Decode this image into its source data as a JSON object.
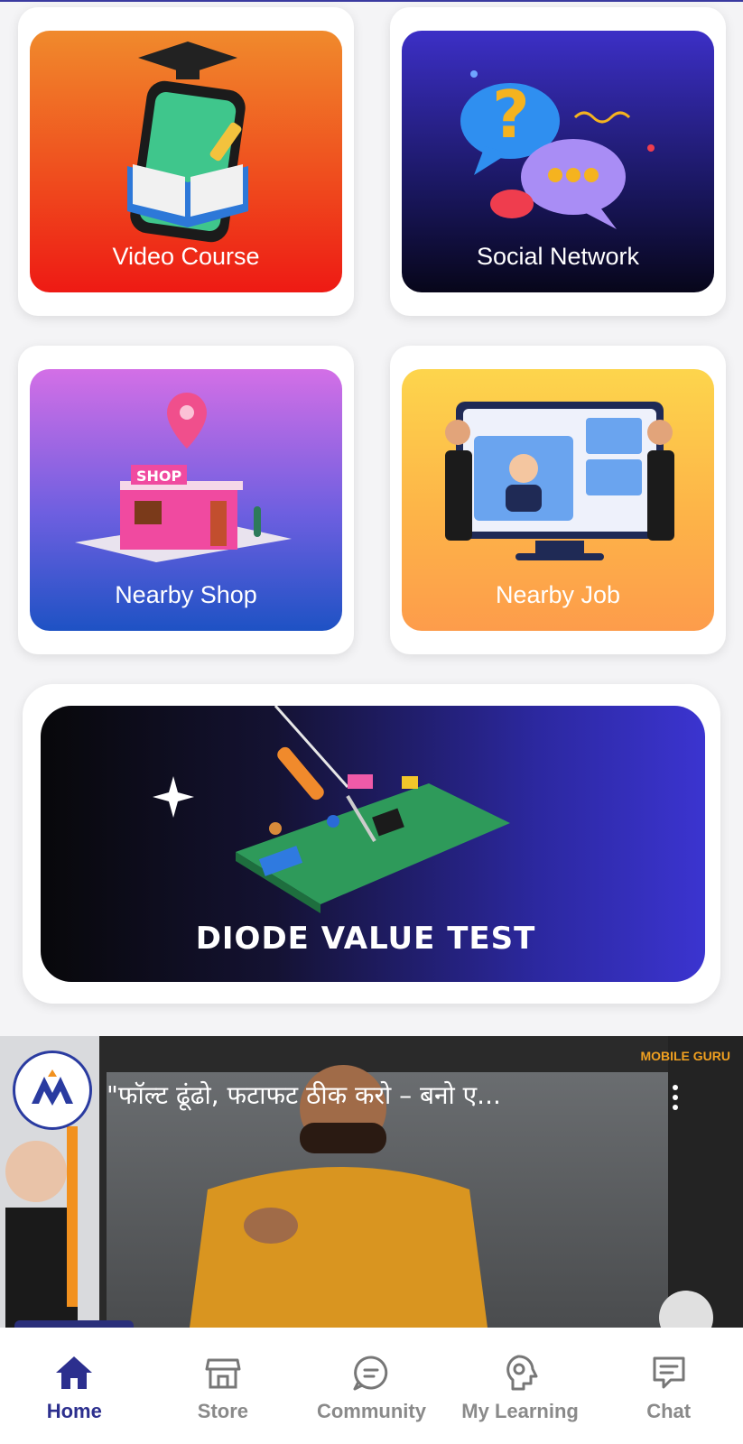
{
  "tiles": {
    "video_course": "Video Course",
    "social_network": "Social Network",
    "nearby_shop": "Nearby Shop",
    "nearby_job": "Nearby Job"
  },
  "banner": {
    "diode_label": "DIODE VALUE TEST"
  },
  "video": {
    "title": "\"फॉल्ट ढूंढो, फटाफट ठीक करो – बनो ए...",
    "brand": "MOBILE GURU",
    "progress_fraction": 0.16
  },
  "nav": {
    "items": [
      {
        "label": "Home",
        "icon": "home-icon",
        "active": true
      },
      {
        "label": "Store",
        "icon": "store-icon",
        "active": false
      },
      {
        "label": "Community",
        "icon": "chat-bubble-icon",
        "active": false
      },
      {
        "label": "My Learning",
        "icon": "head-bulb-icon",
        "active": false
      },
      {
        "label": "Chat",
        "icon": "message-icon",
        "active": false
      }
    ]
  },
  "colors": {
    "primary": "#2c2f8e",
    "inactive": "#8a8a8a"
  }
}
